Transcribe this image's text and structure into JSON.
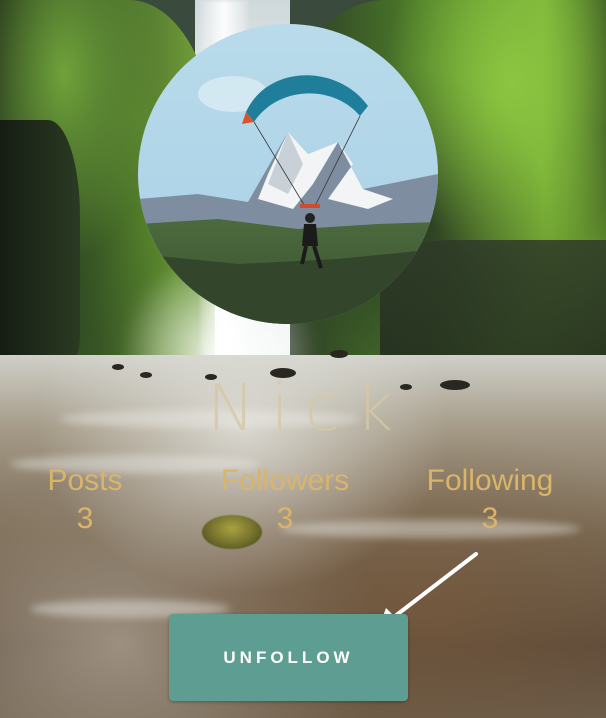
{
  "profile": {
    "username": "Nick",
    "avatar_alt": "paraglider over snowy mountains"
  },
  "stats": [
    {
      "label": "Posts",
      "value": "3"
    },
    {
      "label": "Followers",
      "value": "3"
    },
    {
      "label": "Following",
      "value": "3"
    }
  ],
  "actions": {
    "unfollow_label": "UNFOLLOW"
  },
  "colors": {
    "accent": "#5e9d91",
    "stat_text": "#d9b46a",
    "username_text": "#d6c8a6"
  },
  "icons": {
    "annotation": "arrow-icon"
  }
}
